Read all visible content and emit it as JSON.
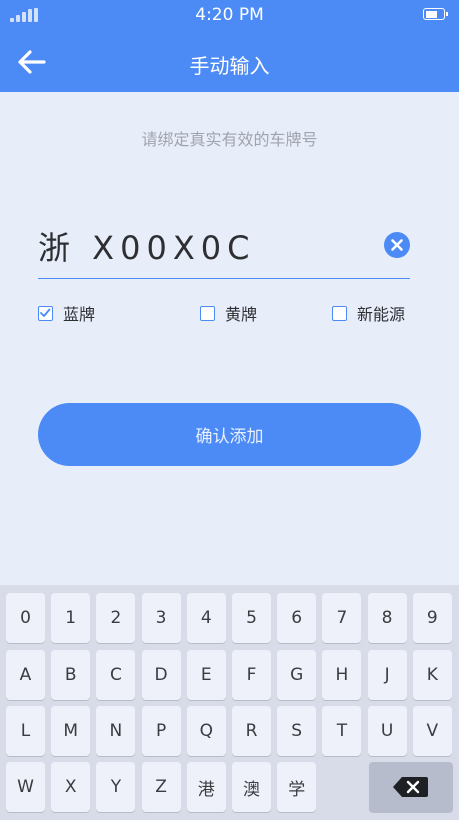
{
  "status_bar": {
    "time": "4:20 PM"
  },
  "nav": {
    "title": "手动输入",
    "back_icon": "arrow-left-icon"
  },
  "hint": "请绑定真实有效的车牌号",
  "plate": {
    "value": "浙 X00X0C",
    "clear_icon": "close-circle-icon"
  },
  "plate_colors": [
    {
      "label": "蓝牌",
      "checked": true
    },
    {
      "label": "黄牌",
      "checked": false
    },
    {
      "label": "新能源",
      "checked": false
    }
  ],
  "confirm_label": "确认添加",
  "keyboard": {
    "rows": [
      [
        "0",
        "1",
        "2",
        "3",
        "4",
        "5",
        "6",
        "7",
        "8",
        "9"
      ],
      [
        "A",
        "B",
        "C",
        "D",
        "E",
        "F",
        "G",
        "H",
        "J",
        "K"
      ],
      [
        "L",
        "M",
        "N",
        "P",
        "Q",
        "R",
        "S",
        "T",
        "U",
        "V"
      ],
      [
        "W",
        "X",
        "Y",
        "Z",
        "港",
        "澳",
        "学"
      ]
    ],
    "delete_icon": "backspace-icon"
  },
  "colors": {
    "accent": "#4c8bf5",
    "background": "#e8edfa",
    "keyboard_bg": "#d8dce8"
  }
}
